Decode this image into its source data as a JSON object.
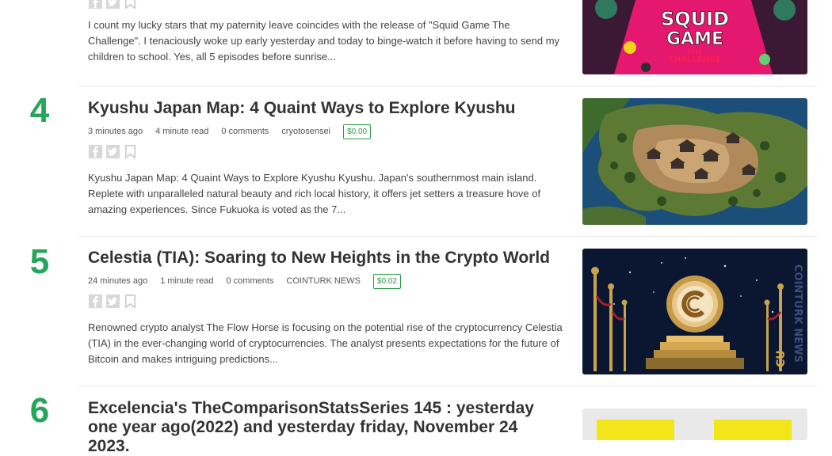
{
  "posts": [
    {
      "body": "I count my lucky stars that my paternity leave coincides with the release of \"Squid Game The Challenge\". I tenaciously woke up early yesterday and today to binge-watch it before having to send my children to school. Yes, all 5 episodes before sunrise...",
      "image_text": [
        "SQUID",
        "GAME",
        "THE",
        "CHALLENGE"
      ]
    },
    {
      "rank": "4",
      "title": "Kyushu Japan Map: 4 Quaint Ways to Explore Kyushu",
      "time": "3 minutes ago",
      "read": "4 minute read",
      "comments": "0 comments",
      "author": "cryotosensei",
      "payout": "$0.00",
      "body": "Kyushu Japan Map: 4 Quaint Ways to Explore Kyushu Kyushu. Japan's southernmost main island. Replete with unparalleled natural beauty and rich local history, it offers jet setters a treasure hove of amazing experiences. Since Fukuoka is voted as the 7..."
    },
    {
      "rank": "5",
      "title": "Celestia (TIA): Soaring to New Heights in the Crypto World",
      "time": "24 minutes ago",
      "read": "1 minute read",
      "comments": "0 comments",
      "author": "COINTURK NEWS",
      "payout": "$0.02",
      "body": "Renowned crypto analyst The Flow Horse is focusing on the potential rise of the cryptocurrency Celestia (TIA) in the ever-changing world of cryptocurrencies. The analyst presents expectations for the future of Bitcoin and makes intriguing predictions...",
      "image_text": [
        "COINTURK NEWS",
        "CU"
      ]
    },
    {
      "rank": "6",
      "title": "Excelencia's TheComparisonStatsSeries 145 : yesterday one year ago(2022) and yesterday friday, November 24 2023."
    }
  ],
  "icons": [
    "facebook-icon",
    "twitter-icon",
    "bookmark-icon"
  ],
  "colors": {
    "rank": "#26a65b",
    "payout": "#2e9b47",
    "squid_bg": "#e4186f",
    "map_sea": "#1b4f7a",
    "crypto_bg": "#0b1630"
  }
}
